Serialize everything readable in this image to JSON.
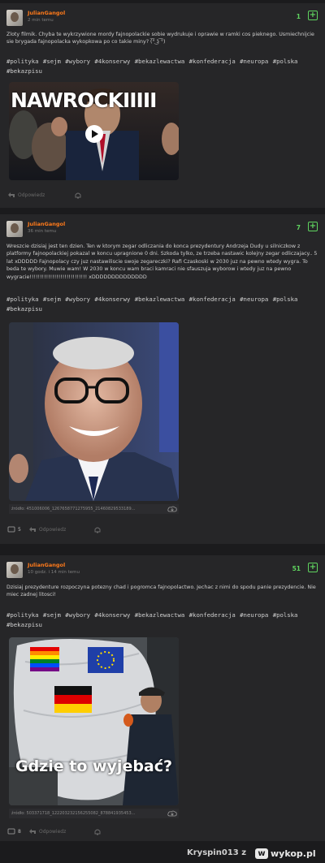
{
  "posts": [
    {
      "author": "JulianGangol",
      "time": "2 min temu",
      "votes": "1",
      "text": "Zloty filmik. Chyba te wykrzywione mordy fajnopolackie sobie wydrukuje i oprawie w ramki cos pieknego. Usmiechnijcie sie brygada fajnopolacka wykopkowa po co takie miny? (͡° ͜ʖ ͡°)",
      "tags": "#polityka #sejm #wybory #4konserwy #bekazlewactwa #konfederacja #neuropa #polska #bekazpisu",
      "thumbnail_text": "NAWROCKIIIII",
      "reply_label": "Odpowiedz",
      "comments": ""
    },
    {
      "author": "JulianGangol",
      "time": "36 min temu",
      "votes": "7",
      "text": "Wreszcie dzisiaj jest ten dzien. Ten w ktorym zegar odliczania do konca prezydentury Andrzeja Dudy u silniczkow z platformy fajnopolackiej pokazal w koncu upragnione 0 dni. Szkoda tylko, ze trzeba nastawic kolejny zegar odliczajacy.. 5 lat xDDDDD Fajnopolacy czy juz nastawiliscie swoje zegareczki? Rafi Czaskoski w 2030 juz na pewno wtedy wygra. To beda te wybory. Muwie wam! W 2030 w koncu wam braci kamraci nie sfauszuja wyborow i wtedy juz na pewno wygracie!!!!!!!!!!!!!!!!!!!!!!!!!!!! xDDDDDDDDDDDDDD",
      "tags": "#polityka #sejm #wybory #4konserwy #bekazlewactwa #konfederacja #neuropa #polska #bekazpisu",
      "source": "źródło: 451006006_1267658771275955_2146082953318​9...",
      "reply_label": "Odpowiedz",
      "comments": "5"
    },
    {
      "author": "JulianGangol",
      "time": "10 godz. i 14 min temu",
      "votes": "51",
      "text": "Dzisiaj prezydenture rozpoczyna potezny chad i pogromca fajnopolactwo. Jechac z nimi do spodu panie prezydencie. Nie miec zadnej litosci!",
      "tags": "#polityka #sejm #wybory #4konserwy #bekazlewactwa #konfederacja #neuropa #polska #bekazpisu",
      "caption": "Gdzie to wyjebać?",
      "source": "źródło: 503371718_1222032321562550​82_878841935453...",
      "reply_label": "Odpowiedz",
      "comments": "8"
    }
  ],
  "footer": {
    "user": "Kryspin013",
    "z": "z",
    "site": "wykop.pl"
  },
  "colors": {
    "accent": "#ff7a1a",
    "vote": "#5fd45f",
    "background": "#1b1b1d",
    "card": "#262628"
  }
}
